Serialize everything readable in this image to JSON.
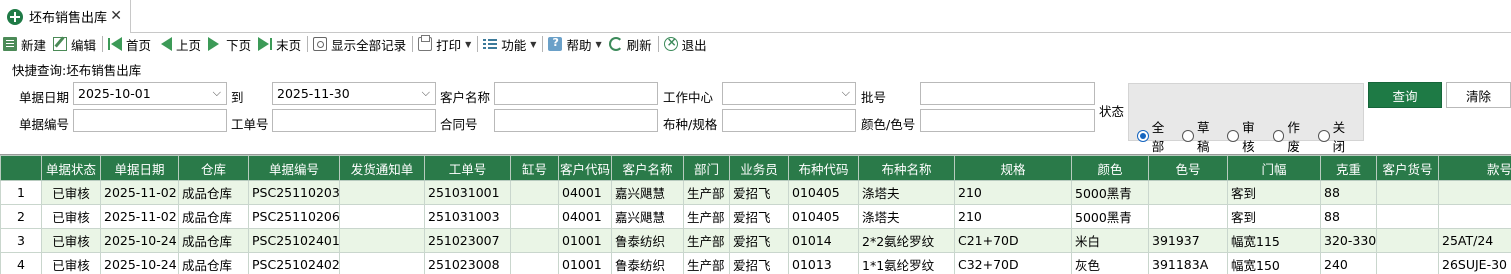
{
  "tab": {
    "title": "坯布销售出库",
    "close": "✕"
  },
  "toolbar": {
    "new": "新建",
    "edit": "编辑",
    "first": "首页",
    "prev": "上页",
    "next": "下页",
    "last": "末页",
    "show_all": "显示全部记录",
    "print": "打印",
    "function": "功能",
    "help": "帮助",
    "refresh": "刷新",
    "exit": "退出"
  },
  "query": {
    "title": "快捷查询:坯布销售出库",
    "date_label": "单据日期",
    "date_from": "2025-10-01",
    "to_label": "到",
    "date_to": "2025-11-30",
    "customer_label": "客户名称",
    "customer_value": "",
    "workcenter_label": "工作中心",
    "workcenter_value": "",
    "batch_label": "批号",
    "batch_value": "",
    "docno_label": "单据编号",
    "docno_value": "",
    "workno_label": "工单号",
    "workno_value": "",
    "contract_label": "合同号",
    "contract_value": "",
    "fabric_label": "布种/规格",
    "fabric_value": "",
    "color_label": "颜色/色号",
    "color_value": "",
    "status_label": "状态",
    "status_options": [
      "全部",
      "草稿",
      "审核",
      "作废",
      "关闭"
    ],
    "status_selected": "全部",
    "query_button": "查询",
    "clear_button": "清除"
  },
  "grid": {
    "columns": [
      "",
      "单据状态",
      "单据日期",
      "仓库",
      "单据编号",
      "发货通知单",
      "工单号",
      "缸号",
      "客户代码",
      "客户名称",
      "部门",
      "业务员",
      "布种代码",
      "布种名称",
      "规格",
      "颜色",
      "色号",
      "门幅",
      "克重",
      "客户货号",
      "款号"
    ],
    "rows": [
      [
        "1",
        "已审核",
        "2025-11-02",
        "成品仓库",
        "PSC25110203",
        "",
        "251031001",
        "",
        "04001",
        "嘉兴飓慧",
        "生产部",
        "爱招飞",
        "010405",
        "涤塔夫",
        "210",
        "5000黑青",
        "",
        "客到",
        "88",
        "",
        ""
      ],
      [
        "2",
        "已审核",
        "2025-11-02",
        "成品仓库",
        "PSC25110206",
        "",
        "251031003",
        "",
        "04001",
        "嘉兴飓慧",
        "生产部",
        "爱招飞",
        "010405",
        "涤塔夫",
        "210",
        "5000黑青",
        "",
        "客到",
        "88",
        "",
        ""
      ],
      [
        "3",
        "已审核",
        "2025-10-24",
        "成品仓库",
        "PSC25102401",
        "",
        "251023007",
        "",
        "01001",
        "鲁泰纺织",
        "生产部",
        "爱招飞",
        "01014",
        "2*2氨纶罗纹",
        "C21+70D",
        "米白",
        "391937",
        "幅宽115",
        "320-330",
        "",
        "25AT/24"
      ],
      [
        "4",
        "已审核",
        "2025-10-24",
        "成品仓库",
        "PSC25102402",
        "",
        "251023008",
        "",
        "01001",
        "鲁泰纺织",
        "生产部",
        "爱招飞",
        "01013",
        "1*1氨纶罗纹",
        "C32+70D",
        "灰色",
        "391183A",
        "幅宽150",
        "240",
        "",
        "26SUJE-30"
      ]
    ]
  }
}
